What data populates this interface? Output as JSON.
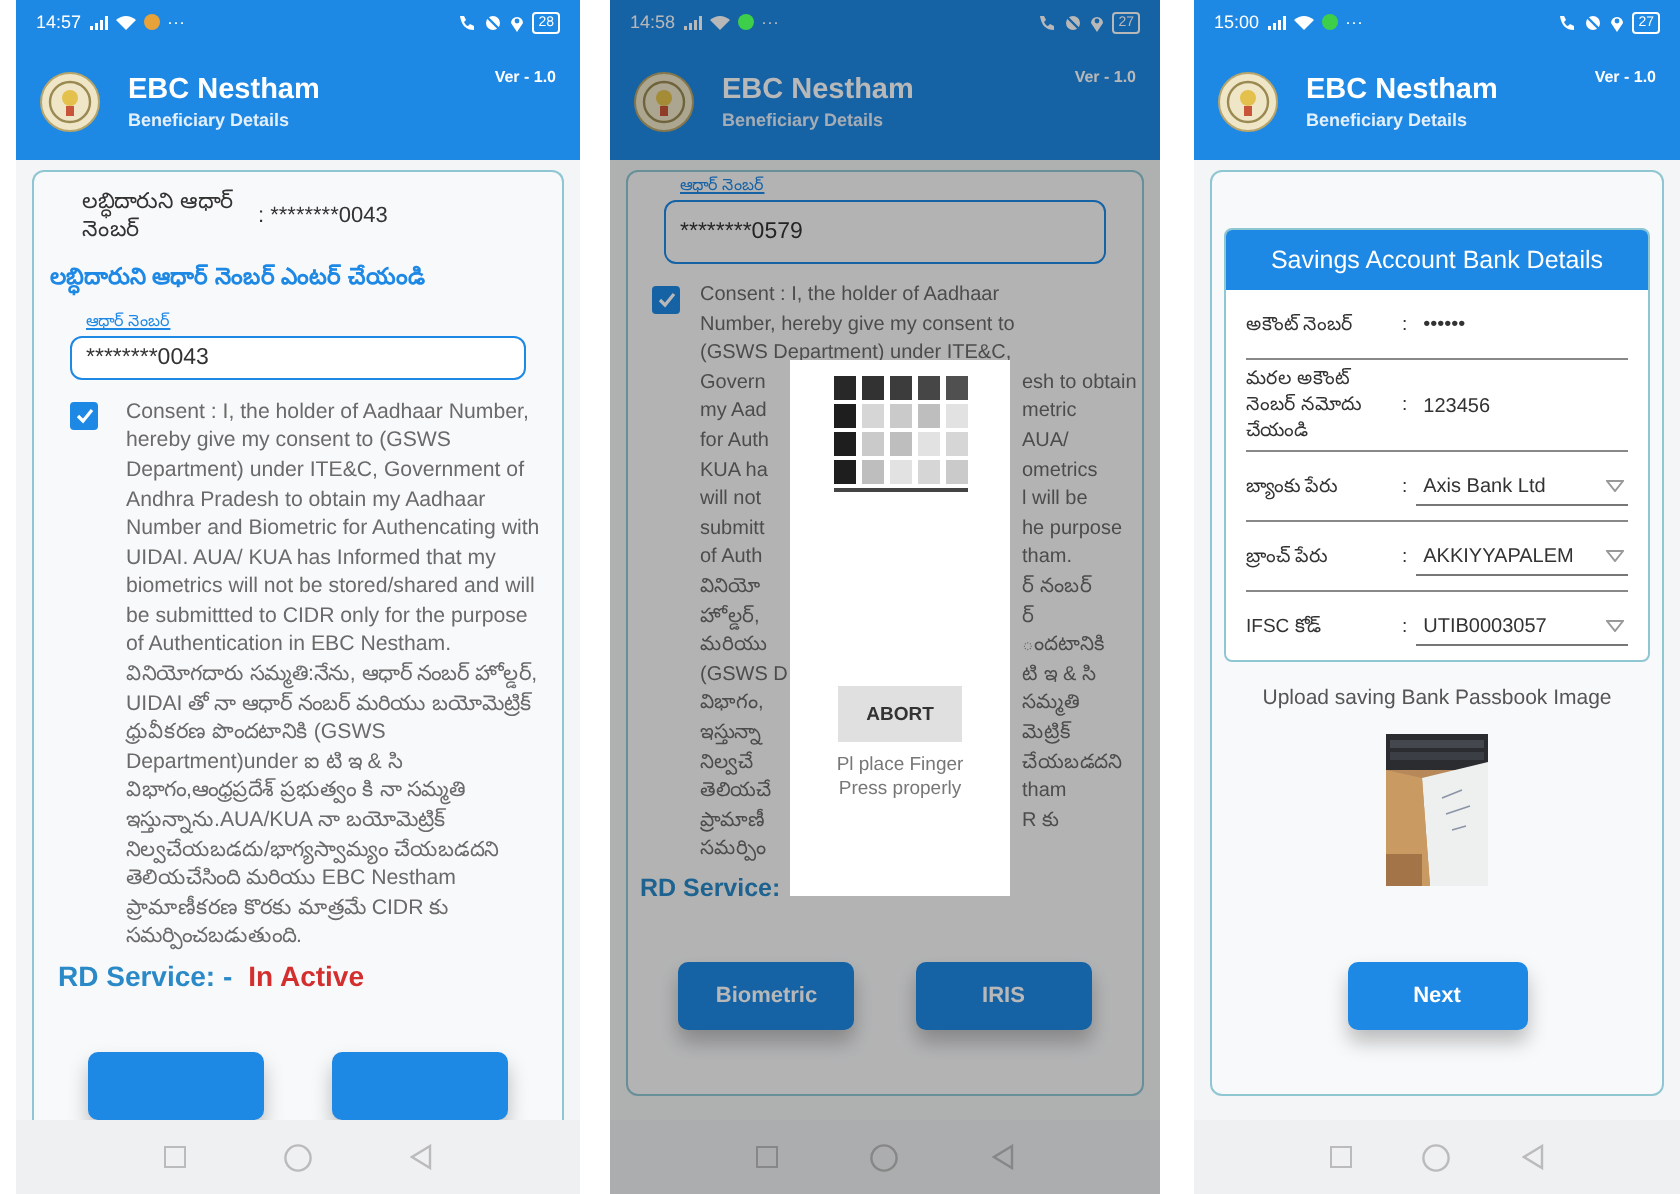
{
  "phones": [
    {
      "kind": "aadhaar",
      "dimmed": false,
      "status_bar": {
        "time": "14:57",
        "more": "···",
        "battery": "28",
        "app_icon": {
          "color": "#e8a23a"
        }
      },
      "header": {
        "title": "EBC Nestham",
        "subtitle": "Beneficiary Details",
        "version": "Ver - 1.0"
      },
      "beneficiary_aadhaar": {
        "label": "లబ్ధిదారుని ఆధార్ నెంబర్",
        "value": ": ********0043"
      },
      "prompt": "లబ్ధిదారుని ఆధార్ నెంబర్ ఎంటర్ చేయండి",
      "aadhaar_field": {
        "label": "ఆధార్ నెంబర్",
        "value": "********0043"
      },
      "consent": {
        "checked": true,
        "text": "Consent : I, the holder of Aadhaar Number, hereby give my consent to (GSWS Department) under ITE&C, Government of Andhra Pradesh to obtain my Aadhaar Number and Biometric for Authencating with UIDAI. AUA/ KUA has Informed that my biometrics will not be stored/shared and will be submittted to CIDR only for the purpose of Authentication in EBC Nestham. వినియోగదారు సమ్మతి:నేను, ఆధార్ నంబర్ హోల్డర్, UIDAI తో నా ఆధార్ నంబర్ మరియు బయోమెట్రిక్ ధ్రువీకరణ పొందటానికి (GSWS Department)under ఐ టి ఇ & సి విభాగం,ఆంధ్రప్రదేశ్ ప్రభుత్వం కి నా సమ్మతి ఇస్తున్నాను.AUA/KUA నా బయోమెట్రిక్ నిల్వచేయబడదు/భాగ్యస్వామ్యం చేయబడదని తెలియచేసింది మరియు EBC Nestham ప్రామాణీకరణ కొరకు మాత్రమే CIDR కు సమర్పించబడుతుంది."
      },
      "rd_service": {
        "label": "RD Service: -",
        "status": "In Active"
      }
    },
    {
      "kind": "aadhaar",
      "dimmed": true,
      "status_bar": {
        "time": "14:58",
        "more": "···",
        "battery": "27",
        "app_icon": {
          "color": "#3ecf4a"
        }
      },
      "header": {
        "title": "EBC Nestham",
        "subtitle": "Beneficiary Details",
        "version": "Ver - 1.0"
      },
      "aadhaar_field": {
        "label": "ఆధార్ నెంబర్",
        "value": "********0579"
      },
      "consent": {
        "checked": true,
        "lines": [
          {
            "text": "Consent : I, the holder of Aadhaar"
          },
          {
            "text": "Number, hereby give my consent to"
          },
          {
            "text": "(GSWS Department) under ITE&C,"
          },
          {
            "left": "Govern",
            "right": "esh to obtain"
          },
          {
            "left": "my Aad",
            "right": "metric"
          },
          {
            "left": "for Auth",
            "right": "AUA/"
          },
          {
            "left": "KUA ha",
            "right": "ometrics"
          },
          {
            "left": "will not",
            "right": "l will be"
          },
          {
            "left": "submitt",
            "right": "he purpose"
          },
          {
            "left": "of Auth",
            "right": "tham."
          },
          {
            "left": "వినియో",
            "right": "ర్ నంబర్"
          },
          {
            "left": "హోల్డర్,",
            "right": "ర్"
          },
          {
            "left": "మరియు",
            "right": "ందటానికి"
          },
          {
            "left": "(GSWS D",
            "right": "టి ఇ & సి"
          },
          {
            "left": "విభాగం,",
            "right": "సమ్మతి"
          },
          {
            "left": "ఇస్తున్నా",
            "right": "మెట్రిక్"
          },
          {
            "left": "నిల్వచే",
            "right": "చేయబడదని"
          },
          {
            "left": "తెలియచే",
            "right": "tham"
          },
          {
            "left": "ప్రామాణీ",
            "right": "R కు"
          },
          {
            "left": "సమర్పిం"
          }
        ]
      },
      "rd_service": {
        "label": "RD Service:"
      },
      "buttons": [
        "Biometric",
        "IRIS"
      ],
      "dialog": {
        "kind": "picture",
        "button": "ABORT",
        "message_lines": [
          "Pl place Finger",
          "Press properly"
        ]
      }
    },
    {
      "kind": "bank",
      "dimmed": false,
      "status_bar": {
        "time": "15:00",
        "more": "···",
        "battery": "27",
        "app_icon": {
          "color": "#3ecf4a"
        }
      },
      "header": {
        "title": "EBC Nestham",
        "subtitle": "Beneficiary Details",
        "version": "Ver - 1.0"
      },
      "panel_title": "Savings Account Bank Details",
      "rows": [
        {
          "label": "అకౌంట్ నెంబర్",
          "sep": ":",
          "value": "••••••",
          "kind": "text"
        },
        {
          "label": "మరల అకౌంట్ నెంబర్ నమోదు చేయండి",
          "sep": ":",
          "value": "123456",
          "kind": "text"
        },
        {
          "label": "బ్యాంకు పేరు",
          "sep": ":",
          "value": "Axis Bank Ltd",
          "kind": "select"
        },
        {
          "label": "బ్రాంచ్ పేరు",
          "sep": ":",
          "value": "AKKIYYAPALEM",
          "kind": "select"
        },
        {
          "label": "IFSC కోడ్",
          "sep": ":",
          "value": "UTIB0003057",
          "kind": "select"
        }
      ],
      "upload_label": "Upload saving Bank Passbook Image",
      "next_button": "Next"
    }
  ]
}
